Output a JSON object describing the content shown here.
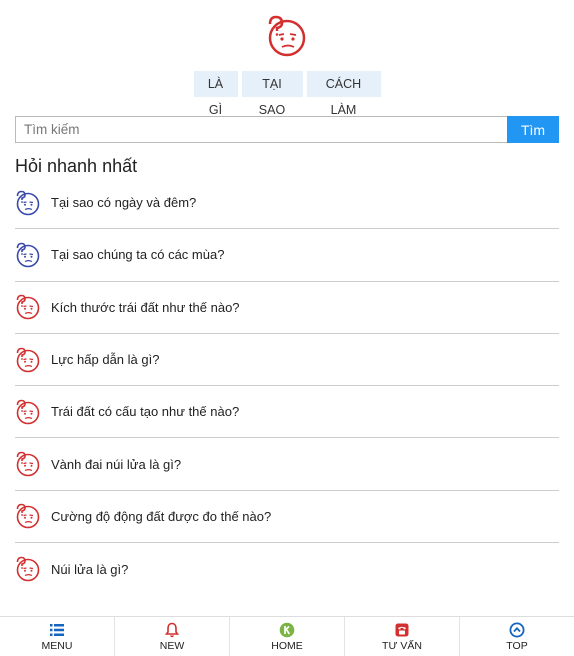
{
  "logo": {
    "icon": "question-face-icon",
    "color": "#d32f2f"
  },
  "tabs": [
    {
      "label": "LÀ GÌ"
    },
    {
      "label": "TẠI SAO"
    },
    {
      "label": "CÁCH LÀM"
    }
  ],
  "search": {
    "placeholder": "Tìm kiếm",
    "value": "",
    "button_label": "Tìm"
  },
  "section_title": "Hỏi nhanh nhất",
  "questions": [
    {
      "text": "Tại sao có ngày và đêm?",
      "icon_color": "#3949ab"
    },
    {
      "text": "Tại sao chúng ta có các mùa?",
      "icon_color": "#3949ab"
    },
    {
      "text": "Kích thước trái đất như thế nào?",
      "icon_color": "#d32f2f"
    },
    {
      "text": "Lực hấp dẫn là gì?",
      "icon_color": "#d32f2f"
    },
    {
      "text": "Trái đất có cấu tạo như thế nào?",
      "icon_color": "#d32f2f"
    },
    {
      "text": "Vành đai núi lửa là gì?",
      "icon_color": "#d32f2f"
    },
    {
      "text": "Cường độ động đất được đo thế nào?",
      "icon_color": "#d32f2f"
    },
    {
      "text": "Núi lửa là gì?",
      "icon_color": "#d32f2f"
    }
  ],
  "bottom_nav": [
    {
      "label": "MENU",
      "icon": "menu-list-icon",
      "color": "#1565c0"
    },
    {
      "label": "NEW",
      "icon": "bell-icon",
      "color": "#d32f2f"
    },
    {
      "label": "HOME",
      "icon": "home-k-icon",
      "color": "#7cb342"
    },
    {
      "label": "TƯ VẤN",
      "icon": "phone-icon",
      "color": "#d32f2f"
    },
    {
      "label": "TOP",
      "icon": "arrow-up-circle-icon",
      "color": "#1565c0"
    }
  ]
}
